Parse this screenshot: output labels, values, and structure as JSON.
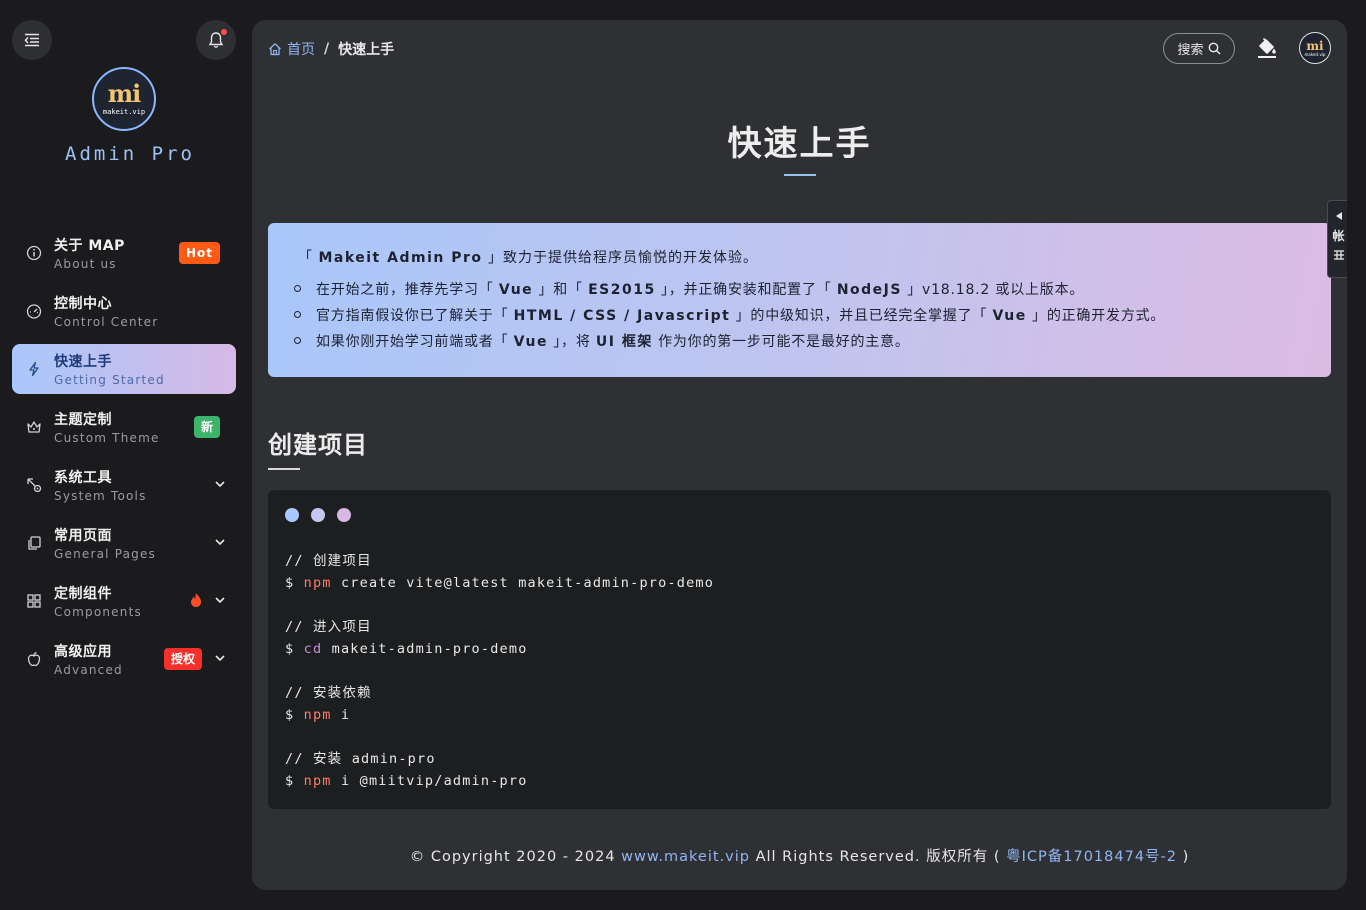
{
  "sidebar": {
    "logo_text": "mi",
    "logo_site": "makeit.vip",
    "brand": "Admin Pro",
    "items": [
      {
        "title": "关于 MAP",
        "sub": "About us",
        "badge": "Hot"
      },
      {
        "title": "控制中心",
        "sub": "Control Center"
      },
      {
        "title": "快速上手",
        "sub": "Getting Started"
      },
      {
        "title": "主题定制",
        "sub": "Custom Theme",
        "badge": "新"
      },
      {
        "title": "系统工具",
        "sub": "System Tools"
      },
      {
        "title": "常用页面",
        "sub": "General Pages"
      },
      {
        "title": "定制组件",
        "sub": "Components"
      },
      {
        "title": "高级应用",
        "sub": "Advanced",
        "badge": "授权"
      }
    ]
  },
  "header": {
    "breadcrumb_home": "首页",
    "breadcrumb_sep": "/",
    "breadcrumb_current": "快速上手",
    "search_label": "搜索",
    "avatar_text": "mi",
    "avatar_site": "makeit.vip"
  },
  "page": {
    "title": "快速上手",
    "side_tab_label": "帐",
    "intro": {
      "lead_prefix": "「 ",
      "lead_brand": "Makeit Admin Pro",
      "lead_suffix": " 」致力于提供给程序员愉悦的开发体验。",
      "bullets": [
        [
          "在开始之前，推荐先学习「 ",
          "Vue",
          " 」和「 ",
          "ES2015",
          " 」，并正确安装和配置了「 ",
          "NodeJS",
          " 」v18.18.2 或以上版本。"
        ],
        [
          "官方指南假设你已了解关于「 ",
          "HTML / CSS / Javascript",
          " 」的中级知识，并且已经完全掌握了「 ",
          "Vue",
          " 」的正确开发方式。"
        ],
        [
          "如果你刚开始学习前端或者「 ",
          "Vue",
          " 」，将 ",
          "UI 框架",
          " 作为你的第一步可能不是最好的主意。"
        ]
      ]
    },
    "section_title": "创建项目",
    "code_dots": [
      "#a9c8fb",
      "#c5c7ef",
      "#d8b9e4"
    ],
    "code_lines": [
      [
        {
          "t": "// 创建项目"
        }
      ],
      [
        {
          "t": "$ "
        },
        {
          "t": "npm",
          "c": "cmd"
        },
        {
          "t": " create vite@latest makeit-admin-pro-demo"
        }
      ],
      [],
      [
        {
          "t": "// 进入项目"
        }
      ],
      [
        {
          "t": "$ "
        },
        {
          "t": "cd",
          "c": "kw"
        },
        {
          "t": " makeit-admin-pro-demo"
        }
      ],
      [],
      [
        {
          "t": "// 安装依赖"
        }
      ],
      [
        {
          "t": "$ "
        },
        {
          "t": "npm",
          "c": "cmd"
        },
        {
          "t": " i"
        }
      ],
      [],
      [
        {
          "t": "// 安装 admin-pro"
        }
      ],
      [
        {
          "t": "$ "
        },
        {
          "t": "npm",
          "c": "cmd"
        },
        {
          "t": " i @miitvip/admin-pro"
        }
      ]
    ],
    "footer": {
      "prefix": "© Copyright 2020 - 2024 ",
      "site_link": "www.makeit.vip",
      "middle": " All Rights Reserved. 版权所有 ( ",
      "icp_link": "粤ICP备17018474号-2",
      "suffix": " )"
    }
  },
  "colors": {
    "accent": "#9ec1f5",
    "hot_badge": "#ff5a14",
    "new_badge": "#3bb56a",
    "auth_badge": "#f5302a"
  },
  "icons": {
    "toggle": "menu-fold-icon",
    "bell": "bell-icon",
    "search": "search-icon",
    "paint": "paint-bucket-icon",
    "home": "home-icon"
  }
}
